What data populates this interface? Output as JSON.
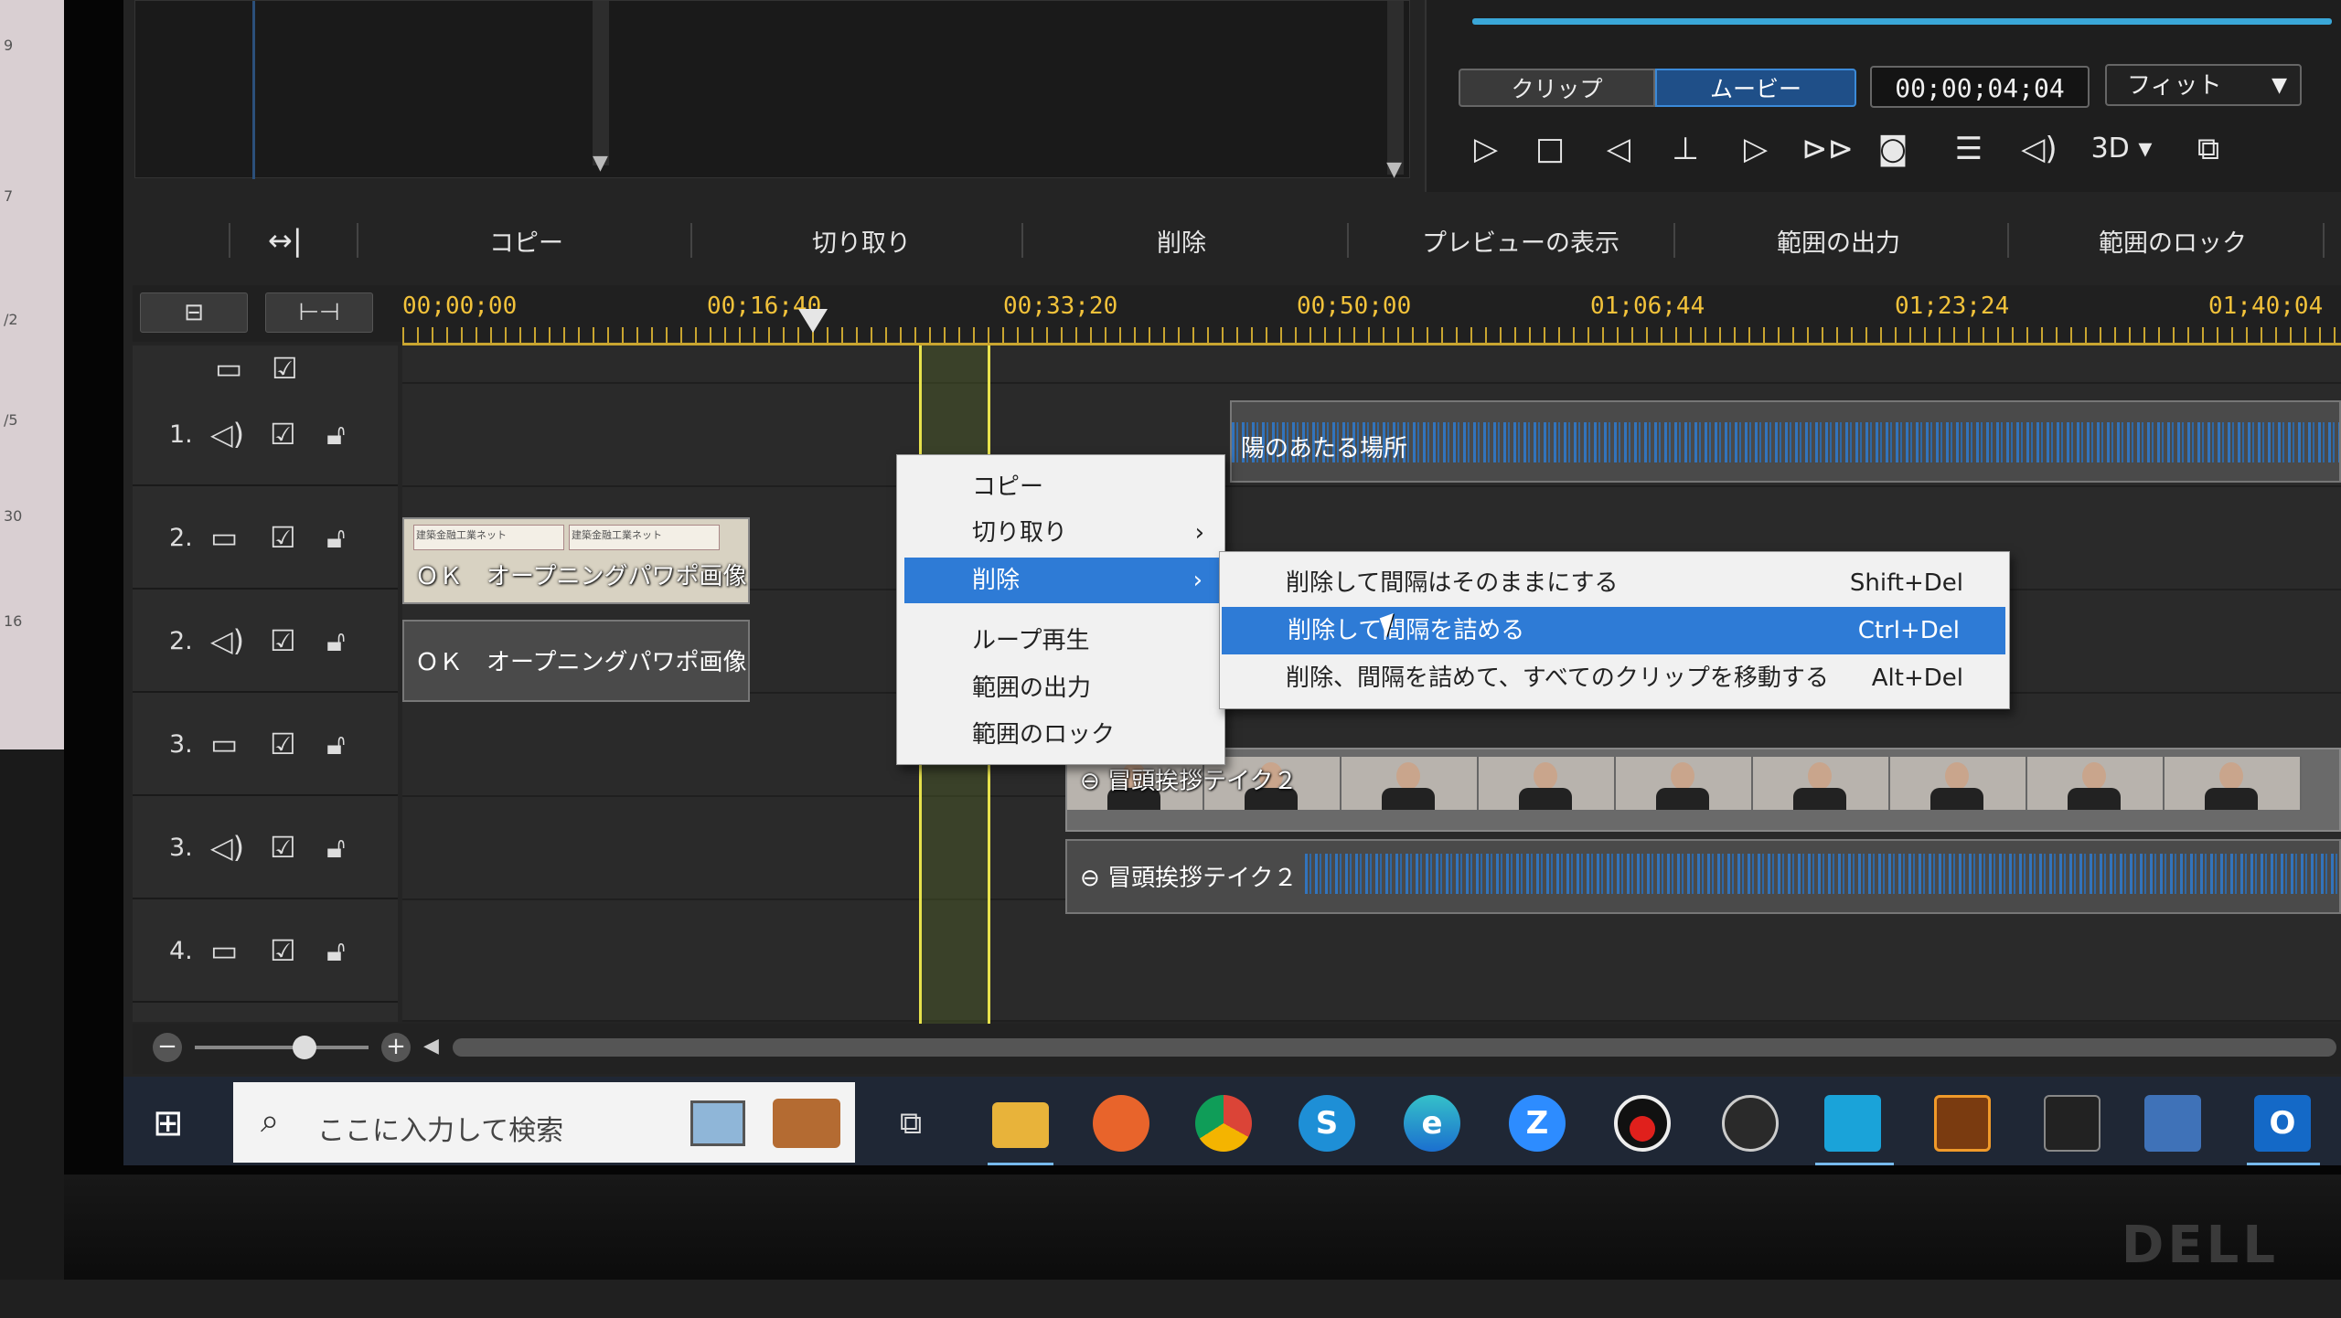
{
  "side_numbers": [
    "9",
    "7",
    "/2",
    "/5",
    "30",
    "16"
  ],
  "preview": {
    "mode_clip": "クリップ",
    "mode_movie": "ムービー",
    "timecode": "00;00;04;04",
    "fit": "フィット",
    "mode_3d": "3D"
  },
  "toolbar": {
    "copy": "コピー",
    "cut": "切り取り",
    "delete": "削除",
    "show_preview": "プレビューの表示",
    "export_range": "範囲の出力",
    "lock_range": "範囲のロック"
  },
  "ruler": {
    "timecodes": [
      "00;00;00",
      "00;16;40",
      "00;33;20",
      "00;50;00",
      "01;06;44",
      "01;23;24",
      "01;40;04"
    ]
  },
  "tracks": [
    {
      "num": "1.",
      "kind": "audio"
    },
    {
      "num": "2.",
      "kind": "video"
    },
    {
      "num": "2.",
      "kind": "audio"
    },
    {
      "num": "3.",
      "kind": "video"
    },
    {
      "num": "3.",
      "kind": "audio"
    },
    {
      "num": "4.",
      "kind": "video"
    }
  ],
  "clips": {
    "audio1": "陽のあたる場所",
    "video2": "ＯＫ　オープニングパワポ画像",
    "audio2": "ＯＫ　オープニングパワポ画像",
    "video3": "冒頭挨拶テイク２",
    "audio3": "冒頭挨拶テイク２",
    "ppt_thumb_text": "建築金融工業ネット"
  },
  "context_menu": {
    "items": [
      {
        "label": "コピー",
        "submenu": false
      },
      {
        "label": "切り取り",
        "submenu": true
      },
      {
        "label": "削除",
        "submenu": true,
        "active": true
      },
      {
        "label": "ループ再生",
        "submenu": false
      },
      {
        "label": "範囲の出力",
        "submenu": false
      },
      {
        "label": "範囲のロック",
        "submenu": false
      }
    ],
    "submenu": [
      {
        "label": "削除して間隔はそのままにする",
        "shortcut": "Shift+Del"
      },
      {
        "label": "削除して間隔を詰める",
        "shortcut": "Ctrl+Del",
        "active": true
      },
      {
        "label": "削除、間隔を詰めて、すべてのクリップを移動する",
        "shortcut": "Alt+Del"
      }
    ]
  },
  "taskbar": {
    "search_placeholder": "ここに入力して検索"
  },
  "brand": "DELL",
  "colors": {
    "accent_blue": "#2e7bd6",
    "timecode_yellow": "#f2c23a",
    "selection_yellow": "#e7e24c",
    "taskbar_bg": "#1f2735"
  }
}
